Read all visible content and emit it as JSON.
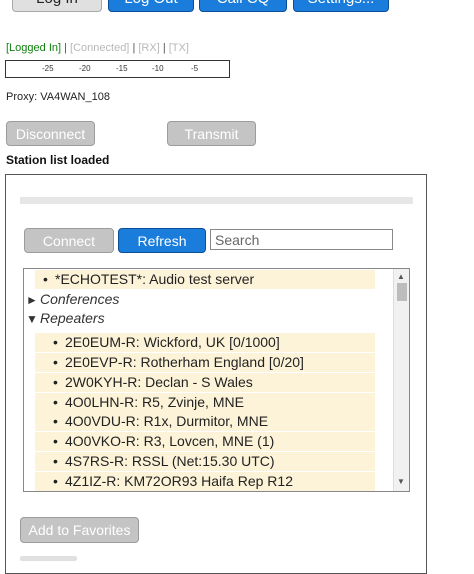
{
  "top_buttons": {
    "login": "Log In",
    "logout": "Log Out",
    "call_cq": "Call CQ",
    "settings": "Settings..."
  },
  "status": {
    "logged_in": "[Logged In]",
    "sep": "|",
    "connected": "[Connected]",
    "rx": "[RX]",
    "tx": "[TX]"
  },
  "meter_ticks": [
    "-25",
    "-20",
    "-15",
    "-10",
    "-5"
  ],
  "proxy": "Proxy: VA4WAN_108",
  "controls": {
    "disconnect": "Disconnect",
    "transmit": "Transmit"
  },
  "list_status": "Station list loaded",
  "station_panel": {
    "connect": "Connect",
    "refresh": "Refresh",
    "search_placeholder": "Search",
    "add_favorites": "Add to Favorites",
    "colors": {
      "accent": "#1a7ddb",
      "highlight": "#fdf3d8",
      "logged_in": "#108010"
    },
    "items": [
      {
        "type": "item",
        "label": "*ECHOTEST*: Audio test server"
      },
      {
        "type": "group",
        "label": "Conferences",
        "expanded": false
      },
      {
        "type": "group",
        "label": "Repeaters",
        "expanded": true
      },
      {
        "type": "item",
        "label": "2E0EUM-R: Wickford, UK [0/1000]"
      },
      {
        "type": "item",
        "label": "2E0EVP-R: Rotherham England [0/20]"
      },
      {
        "type": "item",
        "label": "2W0KYH-R: Declan - S Wales"
      },
      {
        "type": "item",
        "label": "4O0LHN-R: R5, Zvinje, MNE"
      },
      {
        "type": "item",
        "label": "4O0VDU-R: R1x, Durmitor, MNE"
      },
      {
        "type": "item",
        "label": "4O0VKO-R: R3, Lovcen, MNE (1)"
      },
      {
        "type": "item",
        "label": "4S7RS-R: RSSL (Net:15.30 UTC)"
      },
      {
        "type": "item",
        "label": "4Z1IZ-R: KM72OR93 Haifa Rep R12"
      }
    ]
  }
}
